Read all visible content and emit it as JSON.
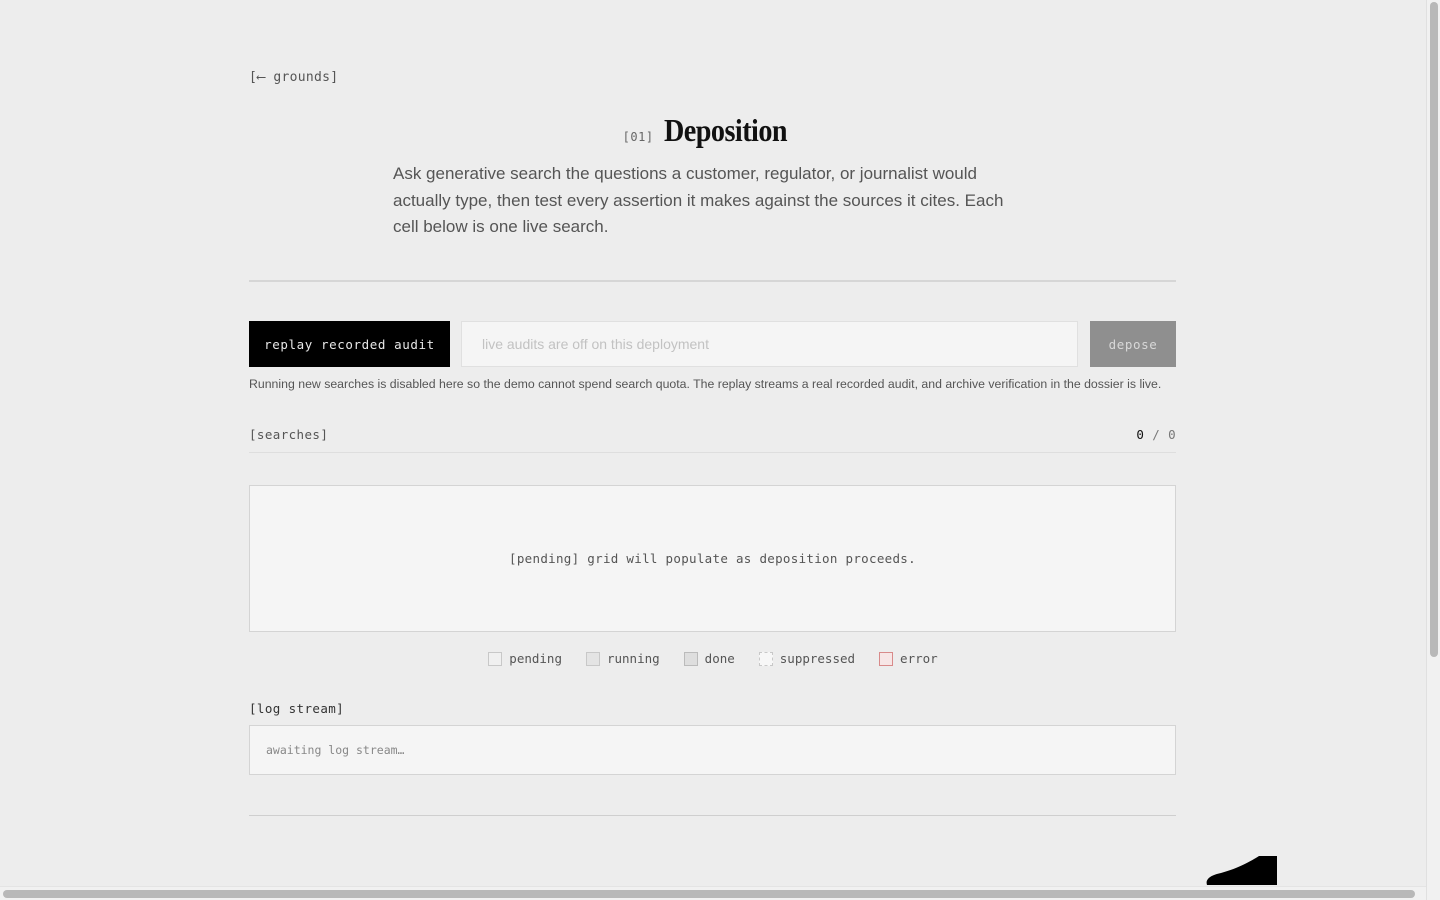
{
  "nav": {
    "back_label": "[⟵ grounds]"
  },
  "header": {
    "number": "[01]",
    "title": "Deposition",
    "intro": "Ask generative search the questions a customer, regulator, or journalist would actually type, then test every assertion it makes against the sources it cites. Each cell below is one live search."
  },
  "controls": {
    "replay_label": "replay recorded audit",
    "query_placeholder": "live audits are off on this deployment",
    "depose_label": "depose",
    "notice": "Running new searches is disabled here so the demo cannot spend search quota. The replay streams a real recorded audit, and archive verification in the dossier is live."
  },
  "searches": {
    "label": "[searches]",
    "done": "0",
    "separator": "/",
    "total": "0",
    "empty_message": "[pending] grid will populate as deposition proceeds."
  },
  "legend": [
    {
      "key": "pending",
      "label": "pending"
    },
    {
      "key": "running",
      "label": "running"
    },
    {
      "key": "done",
      "label": "done"
    },
    {
      "key": "suppressed",
      "label": "suppressed"
    },
    {
      "key": "error",
      "label": "error"
    }
  ],
  "log": {
    "label": "[log stream]",
    "placeholder": "awaiting log stream…"
  },
  "colors": {
    "background": "#ededed",
    "primary_button": "#000000",
    "disabled_button": "#8f8f8f",
    "panel": "#f5f5f5",
    "error": "#d88a8a"
  }
}
